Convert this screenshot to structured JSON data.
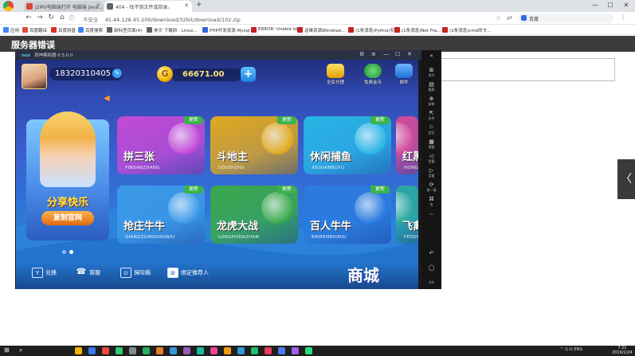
{
  "browser": {
    "tabs": [
      {
        "label": "J2MV电脑端打开 电脑端 Java...",
        "active": false,
        "fav_color": "#d9443a"
      },
      {
        "label": "404 - 找不到文件或目录。",
        "active": true,
        "fav_color": "#5f6368"
      }
    ],
    "new_tab": "+",
    "window_buttons": {
      "minimize": "—",
      "maximize": "☐",
      "close": "✕"
    },
    "nav": {
      "back": "←",
      "forward": "→",
      "reload": "↻",
      "home": "⌂"
    },
    "address": {
      "security": "不安全",
      "url": "45.44.128.45:200/download/32bit/download/102.zip"
    },
    "search": {
      "engine": "百度"
    },
    "bookmarks": [
      {
        "label": "应用",
        "color": "#4285f4"
      },
      {
        "label": "百度翻译",
        "color": "#e34a3a"
      },
      {
        "label": "百度网盘",
        "color": "#d93025"
      },
      {
        "label": "百度搜索",
        "color": "#4285f4"
      },
      {
        "label": "新标签页面(4)",
        "color": "#5f6368"
      },
      {
        "label": "参文 下载网 - Linux...",
        "color": "#5f6368"
      },
      {
        "label": "PHP开发资源 Mysql...",
        "color": "#3367d6"
      },
      {
        "label": "ERROR: Unable to...",
        "color": "#c5221f"
      },
      {
        "label": "运维资源Windows...",
        "color": "#c5221f"
      },
      {
        "label": "(1条消息)Python安装...",
        "color": "#c5221f"
      },
      {
        "label": "(1条消息)Net Fra...",
        "color": "#c5221f"
      },
      {
        "label": "(1条消息)cmd命令...",
        "color": "#c5221f"
      }
    ]
  },
  "page": {
    "error_title": "服务器错误",
    "right_arrow": "〈"
  },
  "emulator": {
    "title": "夜神模拟器 6.5.0.0",
    "title_icons": [
      "⚙",
      "≡",
      "—",
      "☐",
      "✕"
    ],
    "sidebar": [
      {
        "icon": "«",
        "label": ""
      },
      {
        "icon": "⊞",
        "label": "多开"
      },
      {
        "icon": "▤",
        "label": "截屏"
      },
      {
        "icon": "⊕",
        "label": "安装"
      },
      {
        "icon": "⇱",
        "label": "文件"
      },
      {
        "icon": "⚐",
        "label": "定位"
      },
      {
        "icon": "▦",
        "label": "键盘"
      },
      {
        "icon": "◁",
        "label": "音量"
      },
      {
        "icon": "▷",
        "label": "音量"
      },
      {
        "icon": "⟳",
        "label": "摇一摇"
      },
      {
        "icon": "⌘",
        "label": "宏"
      },
      {
        "icon": "⋯",
        "label": ""
      },
      {
        "icon": "↶",
        "label": ""
      },
      {
        "icon": "◯",
        "label": ""
      },
      {
        "icon": "▭",
        "label": ""
      }
    ]
  },
  "game": {
    "user_id": "18320310405",
    "edit_icon": "✎",
    "coin_icon": "G",
    "coins": "66671.00",
    "add_coins": "+",
    "top_icons": [
      {
        "label": "全民代理",
        "color": "#f0c020"
      },
      {
        "label": "免费金币",
        "color": "#2aa84a"
      },
      {
        "label": "邮件",
        "color": "#2e8ff0"
      }
    ],
    "speaker_icon": "◀",
    "featured": {
      "title": "分享快乐",
      "button": "复制官网"
    },
    "new_badge": "更新",
    "games": [
      {
        "name": "拼三张",
        "pinyin": "PINSANZHANG",
        "color": "#c34ad6"
      },
      {
        "name": "斗地主",
        "pinyin": "DOUDIZHU",
        "color": "#e0a920"
      },
      {
        "name": "休闲捕鱼",
        "pinyin": "XIUXIANBUYU",
        "color": "#28b6e6"
      },
      {
        "name": "红黑大战",
        "pinyin": "HONGHEI",
        "color": "#d04a9a"
      },
      {
        "name": "抢庄牛牛",
        "pinyin": "QIANGZUANGNIUNIU",
        "color": "#3b9ae8"
      },
      {
        "name": "龙虎大战",
        "pinyin": "LONGHUDAZHAN",
        "color": "#39a94a"
      },
      {
        "name": "百人牛牛",
        "pinyin": "BAIRENNIUNIU",
        "color": "#2a7be0"
      },
      {
        "name": "飞禽走兽",
        "pinyin": "FEIQIN",
        "color": "#2aa8a0"
      }
    ],
    "bottom": [
      {
        "icon": "Y",
        "label": "兑换"
      },
      {
        "icon": "☎",
        "label": "客服"
      },
      {
        "icon": "⊙",
        "label": "保险箱"
      },
      {
        "icon": "⊞",
        "label": "绑定推荐人"
      }
    ],
    "mall": "商城"
  },
  "taskbar": {
    "start": "⊞",
    "search": "⌕",
    "apps": [
      "#f5b400",
      "#3b78e7",
      "#e74c3c",
      "#2ecc71",
      "#7f8c8d",
      "#27ae60",
      "#e67e22",
      "#3498db",
      "#9b59b6",
      "#1abc9c",
      "#e84393",
      "#f39c12",
      "#2d98da",
      "#20bf6b",
      "#eb3b5a",
      "#4b7bec",
      "#a55eea",
      "#26de81"
    ],
    "tray": "^  ⊡  ☊  ENG",
    "time": "7:21",
    "date": "2019/1/24"
  }
}
